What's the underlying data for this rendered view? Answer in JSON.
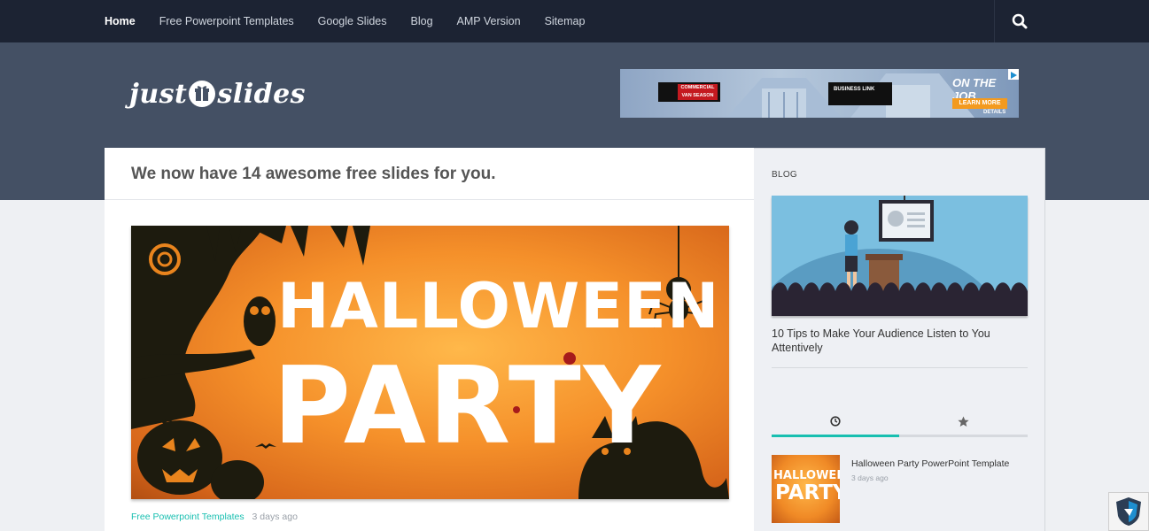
{
  "nav": {
    "items": [
      {
        "label": "Home",
        "active": true
      },
      {
        "label": "Free Powerpoint Templates",
        "active": false
      },
      {
        "label": "Google Slides",
        "active": false
      },
      {
        "label": "Blog",
        "active": false
      },
      {
        "label": "AMP Version",
        "active": false
      },
      {
        "label": "Sitemap",
        "active": false
      }
    ],
    "search_icon": "search-icon"
  },
  "logo": {
    "text_left": "just",
    "text_right": "slides",
    "icon": "gift-icon"
  },
  "ad": {
    "ram_line1": "COMMERCIAL",
    "ram_line2": "VAN SEASON",
    "business_link": "BUSINESS LINK",
    "on_the_job": "ON THE JOB",
    "learn_more": "LEARN MORE",
    "details": "DETAILS"
  },
  "main": {
    "headline": "We now have 14 awesome free slides for you.",
    "hero": {
      "line1": "HALLOWEEN",
      "line2": "PARTY"
    },
    "post_category": "Free Powerpoint Templates",
    "post_date": "3 days ago"
  },
  "sidebar": {
    "section_label": "BLOG",
    "featured_post_title": "10 Tips to Make Your Audience Listen to You Attentively",
    "tabs": [
      {
        "icon": "clock-icon",
        "active": true
      },
      {
        "icon": "star-icon",
        "active": false
      }
    ],
    "recent_item": {
      "title": "Halloween Party PowerPoint Template",
      "date": "3 days ago",
      "thumb_line1": "HALLOWEEN",
      "thumb_line2": "PARTY"
    }
  },
  "colors": {
    "nav_bg": "#1c2333",
    "header_bg": "#445064",
    "accent": "#18bfb0",
    "page_bg": "#eef0f3"
  }
}
